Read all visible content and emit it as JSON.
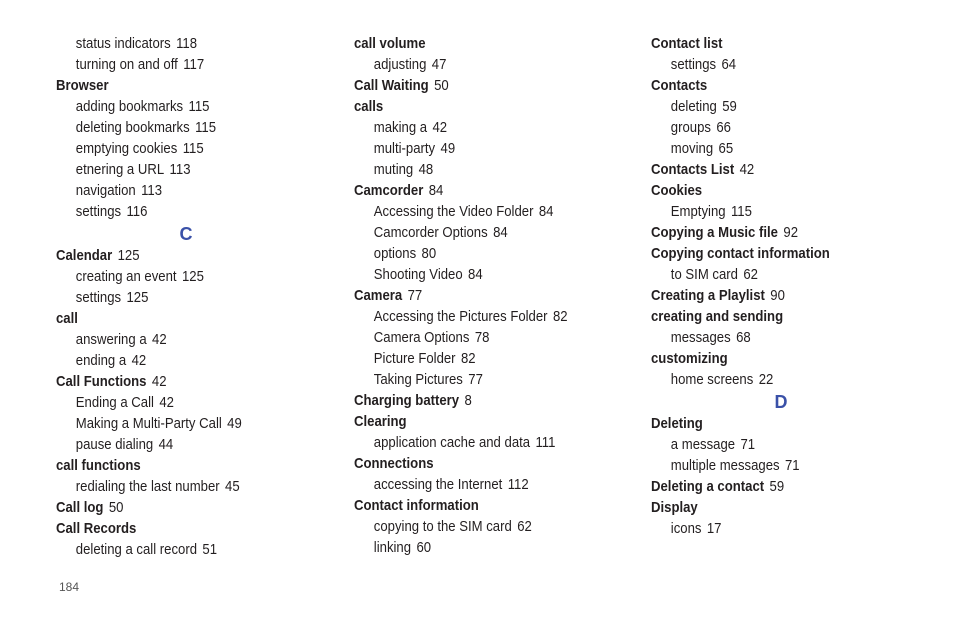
{
  "page_number": "184",
  "accent_color": "#3a51a8",
  "columns": [
    {
      "entries": [
        {
          "type": "sub",
          "term": "status indicators",
          "page": "118"
        },
        {
          "type": "sub",
          "term": "turning on and off",
          "page": "117"
        },
        {
          "type": "main",
          "term": "Browser",
          "page": ""
        },
        {
          "type": "sub",
          "term": "adding bookmarks",
          "page": "115"
        },
        {
          "type": "sub",
          "term": "deleting bookmarks",
          "page": "115"
        },
        {
          "type": "sub",
          "term": "emptying cookies",
          "page": "115"
        },
        {
          "type": "sub",
          "term": "etnering a URL",
          "page": "113"
        },
        {
          "type": "sub",
          "term": "navigation",
          "page": "113"
        },
        {
          "type": "sub",
          "term": "settings",
          "page": "116"
        },
        {
          "type": "letter",
          "term": "C",
          "page": ""
        },
        {
          "type": "main",
          "term": "Calendar",
          "page": "125"
        },
        {
          "type": "sub",
          "term": "creating an event",
          "page": "125"
        },
        {
          "type": "sub",
          "term": "settings",
          "page": "125"
        },
        {
          "type": "main",
          "term": "call",
          "page": ""
        },
        {
          "type": "sub",
          "term": "answering a",
          "page": "42"
        },
        {
          "type": "sub",
          "term": "ending a",
          "page": "42"
        },
        {
          "type": "main",
          "term": "Call Functions",
          "page": "42"
        },
        {
          "type": "sub",
          "term": "Ending a Call",
          "page": "42"
        },
        {
          "type": "sub",
          "term": "Making a Multi-Party Call",
          "page": "49"
        },
        {
          "type": "sub",
          "term": "pause dialing",
          "page": "44"
        },
        {
          "type": "main",
          "term": "call functions",
          "page": ""
        },
        {
          "type": "sub",
          "term": "redialing the last number",
          "page": "45"
        },
        {
          "type": "main",
          "term": "Call log",
          "page": "50"
        },
        {
          "type": "main",
          "term": "Call Records",
          "page": ""
        },
        {
          "type": "sub",
          "term": "deleting a call record",
          "page": "51"
        }
      ]
    },
    {
      "entries": [
        {
          "type": "main",
          "term": "call volume",
          "page": ""
        },
        {
          "type": "sub",
          "term": "adjusting",
          "page": "47"
        },
        {
          "type": "main",
          "term": "Call Waiting",
          "page": "50"
        },
        {
          "type": "main",
          "term": "calls",
          "page": ""
        },
        {
          "type": "sub",
          "term": "making a",
          "page": "42"
        },
        {
          "type": "sub",
          "term": "multi-party",
          "page": "49"
        },
        {
          "type": "sub",
          "term": "muting",
          "page": "48"
        },
        {
          "type": "main",
          "term": "Camcorder",
          "page": "84"
        },
        {
          "type": "sub",
          "term": "Accessing the Video Folder",
          "page": "84"
        },
        {
          "type": "sub",
          "term": "Camcorder Options",
          "page": "84"
        },
        {
          "type": "sub",
          "term": "options",
          "page": "80"
        },
        {
          "type": "sub",
          "term": "Shooting Video",
          "page": "84"
        },
        {
          "type": "main",
          "term": "Camera",
          "page": "77"
        },
        {
          "type": "sub",
          "term": "Accessing the Pictures Folder",
          "page": "82"
        },
        {
          "type": "sub",
          "term": "Camera Options",
          "page": "78"
        },
        {
          "type": "sub",
          "term": "Picture Folder",
          "page": "82"
        },
        {
          "type": "sub",
          "term": "Taking Pictures",
          "page": "77"
        },
        {
          "type": "main",
          "term": "Charging battery",
          "page": "8"
        },
        {
          "type": "main",
          "term": "Clearing",
          "page": ""
        },
        {
          "type": "sub",
          "term": "application cache and data",
          "page": "111"
        },
        {
          "type": "main",
          "term": "Connections",
          "page": ""
        },
        {
          "type": "sub",
          "term": "accessing the Internet",
          "page": "112"
        },
        {
          "type": "main",
          "term": "Contact information",
          "page": ""
        },
        {
          "type": "sub",
          "term": "copying to the SIM card",
          "page": "62"
        },
        {
          "type": "sub",
          "term": "linking",
          "page": "60"
        }
      ]
    },
    {
      "entries": [
        {
          "type": "main",
          "term": "Contact list",
          "page": ""
        },
        {
          "type": "sub",
          "term": "settings",
          "page": "64"
        },
        {
          "type": "main",
          "term": "Contacts",
          "page": ""
        },
        {
          "type": "sub",
          "term": "deleting",
          "page": "59"
        },
        {
          "type": "sub",
          "term": "groups",
          "page": "66"
        },
        {
          "type": "sub",
          "term": "moving",
          "page": "65"
        },
        {
          "type": "main",
          "term": "Contacts List",
          "page": "42"
        },
        {
          "type": "main",
          "term": "Cookies",
          "page": ""
        },
        {
          "type": "sub",
          "term": "Emptying",
          "page": "115"
        },
        {
          "type": "main",
          "term": "Copying a Music file",
          "page": "92"
        },
        {
          "type": "main",
          "term": "Copying contact information",
          "page": ""
        },
        {
          "type": "sub",
          "term": "to SIM card",
          "page": "62"
        },
        {
          "type": "main",
          "term": "Creating a Playlist",
          "page": "90"
        },
        {
          "type": "main",
          "term": "creating and sending",
          "page": ""
        },
        {
          "type": "sub",
          "term": "messages",
          "page": "68"
        },
        {
          "type": "main",
          "term": "customizing",
          "page": ""
        },
        {
          "type": "sub",
          "term": "home screens",
          "page": "22"
        },
        {
          "type": "letter",
          "term": "D",
          "page": ""
        },
        {
          "type": "main",
          "term": "Deleting",
          "page": ""
        },
        {
          "type": "sub",
          "term": "a message",
          "page": "71"
        },
        {
          "type": "sub",
          "term": "multiple messages",
          "page": "71"
        },
        {
          "type": "main",
          "term": "Deleting a contact",
          "page": "59"
        },
        {
          "type": "main",
          "term": "Display",
          "page": ""
        },
        {
          "type": "sub",
          "term": "icons",
          "page": "17"
        }
      ]
    }
  ]
}
